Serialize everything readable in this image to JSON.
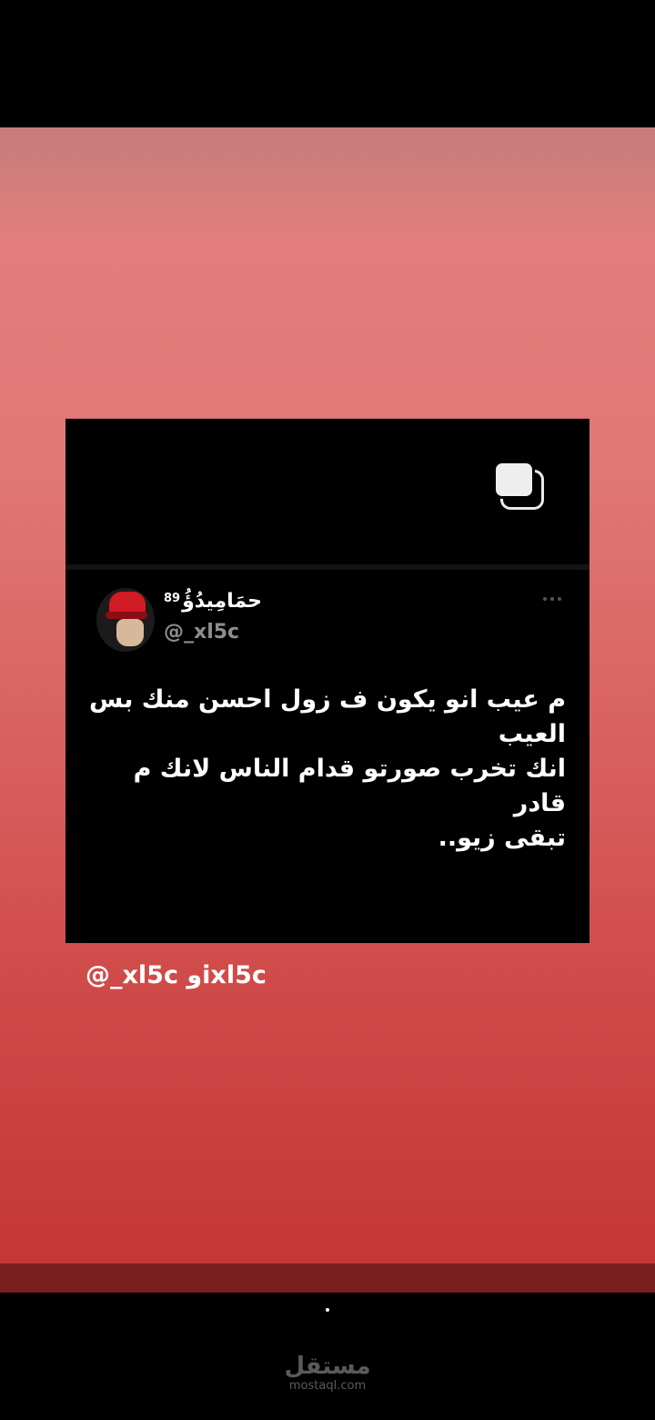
{
  "tweet": {
    "display_name": "حمَامِيدُؤُ",
    "name_suffix": "89",
    "handle": "@_xl5c",
    "lines": [
      "م عيب انو يكون ف زول احسن منك بس العيب",
      "انك تخرب صورتو قدام الناس لانك م قادر",
      "تبقى زيو.."
    ]
  },
  "story": {
    "credit": "@_xl5c وixl5c"
  },
  "watermark": {
    "arabic": "مستقل",
    "latin": "mostaql.com"
  },
  "colors": {
    "story_top": "#e27e7e",
    "story_bottom": "#c53636",
    "card_bg": "#000000"
  },
  "icons": [
    "copy-icon",
    "more-icon",
    "avatar"
  ]
}
